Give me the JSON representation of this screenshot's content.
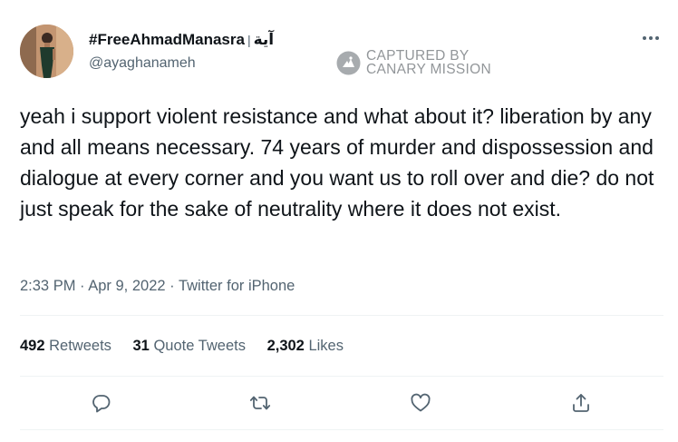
{
  "author": {
    "display_name": "#FreeAhmadManasra",
    "name_separator": "|",
    "arabic_name": "آية",
    "handle": "@ayaghanameh"
  },
  "watermark": {
    "line1": "CAPTURED BY",
    "line2": "CANARY MISSION"
  },
  "tweet": {
    "text": "yeah i support violent resistance and what about it? liberation by any and all means necessary. 74 years of murder and dispossession and dialogue at every corner and you want us to roll over and die? do not just speak for the sake of neutrality where it does not exist.",
    "time": "2:33 PM",
    "date": "Apr 9, 2022",
    "source": "Twitter for iPhone",
    "dot": "·"
  },
  "stats": {
    "retweets_count": "492",
    "retweets_label": "Retweets",
    "quotes_count": "31",
    "quotes_label": "Quote Tweets",
    "likes_count": "2,302",
    "likes_label": "Likes"
  },
  "icons": {
    "more": "more-horizontal-icon",
    "reply": "reply-icon",
    "retweet": "retweet-icon",
    "like": "heart-icon",
    "share": "share-icon"
  },
  "colors": {
    "text_primary": "#0f1419",
    "text_secondary": "#536471",
    "divider": "#eff3f4"
  }
}
